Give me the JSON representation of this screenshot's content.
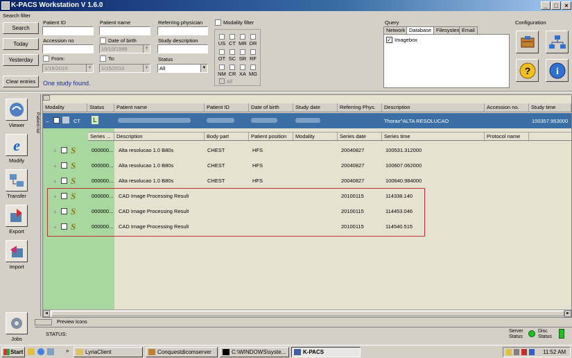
{
  "window": {
    "title": "K-PACS Workstation V 1.6.0"
  },
  "search": {
    "section_label": "Search filter",
    "buttons": {
      "search": "Search",
      "today": "Today",
      "yesterday": "Yesterday",
      "clear": "Clear entries"
    },
    "patient_id_label": "Patient ID",
    "patient_name_label": "Patient name",
    "referring_label": "Referring physician",
    "accession_label": "Accession no",
    "dob_label": "Date of birth",
    "dob_value": "10/10/1999",
    "study_desc_label": "Study description",
    "from_label": "From:",
    "from_value": "1/15/2010",
    "to_label": "To:",
    "to_value": "1/15/2010",
    "status_label": "Status",
    "status_value": "All",
    "result_text": "One study found.",
    "modality_filter_label": "Modality filter",
    "modalities": [
      "US",
      "CT",
      "MR",
      "DR",
      "OT",
      "SC",
      "SR",
      "RF",
      "NM",
      "CR",
      "XA",
      "MG"
    ],
    "all_label": "All"
  },
  "query": {
    "label": "Query",
    "tabs": [
      "Network",
      "Database",
      "Filesystem",
      "Email"
    ],
    "active_tab": "Database",
    "items": [
      "Imagebox"
    ]
  },
  "config": {
    "label": "Configuration"
  },
  "sidebar": {
    "items": [
      {
        "label": "Viewer",
        "icon": "viewer-icon"
      },
      {
        "label": "Modify",
        "icon": "modify-icon"
      },
      {
        "label": "Transfer",
        "icon": "transfer-icon"
      },
      {
        "label": "Export",
        "icon": "export-icon"
      },
      {
        "label": "Import",
        "icon": "import-icon"
      },
      {
        "label": "Jobs",
        "icon": "jobs-icon"
      }
    ],
    "vertical_tab": "Patient list"
  },
  "study_columns": [
    "Modality",
    "Status",
    "Patient name",
    "Patient ID",
    "Date of birth",
    "Study date",
    "Referring Phys.",
    "Description",
    "Accession no.",
    "Study time"
  ],
  "study_row": {
    "modality": "CT",
    "description": "Thorax^ALTA RESOLUCAO",
    "study_time": "100357.953000"
  },
  "series_columns": [
    "Series ...",
    "Description",
    "Body part",
    "Patient position",
    "Modality",
    "Series date",
    "Series time",
    "Protocol name"
  ],
  "series": [
    {
      "num": "000000...",
      "desc": "Alta resolucao 1.0 B80s",
      "body": "CHEST",
      "pos": "HFS",
      "date": "20040827",
      "time": "100531.312000"
    },
    {
      "num": "000000...",
      "desc": "Alta resolucao 1.0 B80s",
      "body": "CHEST",
      "pos": "HFS",
      "date": "20040827",
      "time": "100607.062000"
    },
    {
      "num": "000000...",
      "desc": "Alta resolucao 1.0 B80s",
      "body": "CHEST",
      "pos": "HFS",
      "date": "20040827",
      "time": "100640.984000"
    },
    {
      "num": "000000...",
      "desc": "CAD Image Processing Result",
      "body": "",
      "pos": "",
      "date": "20100115",
      "time": "114338.140"
    },
    {
      "num": "000000...",
      "desc": "CAD Image Processing Result",
      "body": "",
      "pos": "",
      "date": "20100115",
      "time": "114453.046"
    },
    {
      "num": "000000...",
      "desc": "CAD Image Processing Result",
      "body": "",
      "pos": "",
      "date": "20100115",
      "time": "114540.515"
    }
  ],
  "preview_label": "Preview Icons",
  "status_bar": {
    "status_label": "STATUS:",
    "server_label": "Server Status",
    "disc_label": "Disc Status"
  },
  "taskbar": {
    "start": "Start",
    "tasks": [
      "LyriaClient",
      "Conquestdicomserver",
      "C:\\WINDOWS\\syste...",
      "K-PACS"
    ],
    "clock": "11:52 AM"
  },
  "colors": {
    "green_panel": "#a8d8a0",
    "selected_row": "#3a6ea5",
    "highlight_box": "#c03030",
    "series_bg": "#e6e2d0"
  }
}
